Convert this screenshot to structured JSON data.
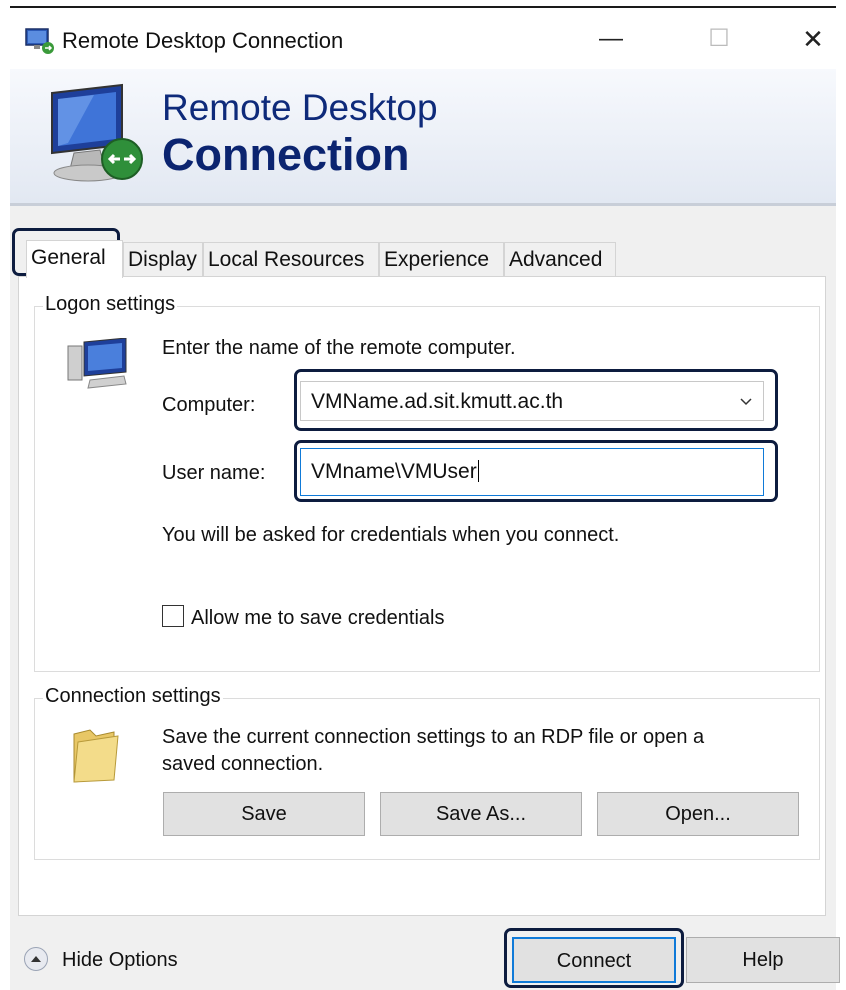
{
  "window": {
    "title": "Remote Desktop Connection",
    "minimize_glyph": "—",
    "maximize_glyph": "☐",
    "close_glyph": "✕"
  },
  "banner": {
    "line1": "Remote Desktop",
    "line2": "Connection"
  },
  "tabs": [
    {
      "label": "General",
      "active": true
    },
    {
      "label": "Display",
      "active": false
    },
    {
      "label": "Local Resources",
      "active": false
    },
    {
      "label": "Experience",
      "active": false
    },
    {
      "label": "Advanced",
      "active": false
    }
  ],
  "logon": {
    "group_title": "Logon settings",
    "instruction": "Enter the name of the remote computer.",
    "computer_label": "Computer:",
    "computer_value": "VMName.ad.sit.kmutt.ac.th",
    "username_label": "User name:",
    "username_value": "VMname\\VMUser",
    "credentials_note": "You will be asked for credentials when you connect.",
    "save_credentials_label": "Allow me to save credentials",
    "save_credentials_checked": false
  },
  "connection_settings": {
    "group_title": "Connection settings",
    "description_line1": "Save the current connection settings to an RDP file or open a",
    "description_line2": "saved connection.",
    "save_label": "Save",
    "save_as_label": "Save As...",
    "open_label": "Open..."
  },
  "footer": {
    "hide_options_label": "Hide Options",
    "connect_label": "Connect",
    "help_label": "Help"
  },
  "icons": {
    "app": "remote-desktop-icon",
    "banner": "monitor-connection-icon",
    "logon": "computer-icon",
    "connection": "folder-icon",
    "combo": "chevron-down-icon",
    "hide": "chevron-up-icon"
  },
  "colors": {
    "banner_title": "#0b2470",
    "highlight_border": "#0d1c3f",
    "focus_border": "#0f7ad8",
    "dialog_background": "#f0f0f0"
  }
}
